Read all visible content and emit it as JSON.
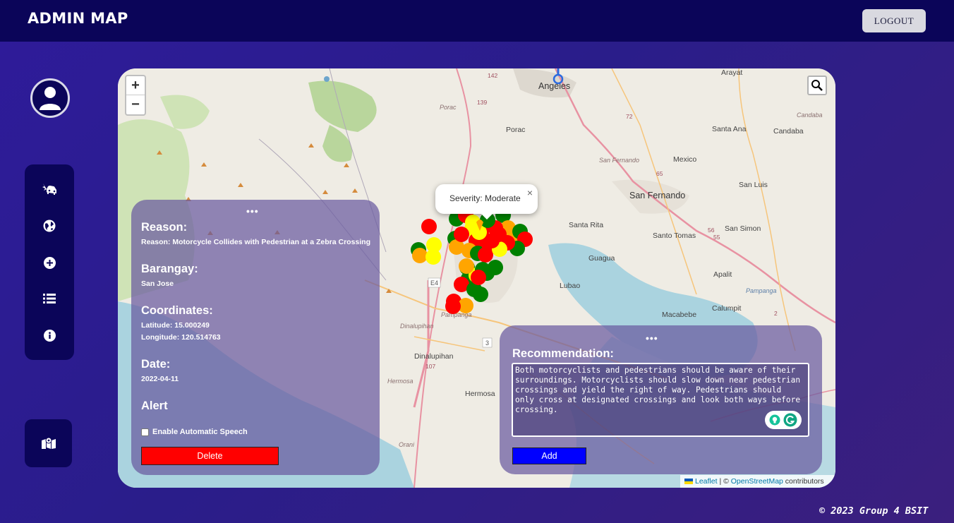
{
  "header": {
    "title": "ADMIN MAP",
    "logout_label": "LOGOUT"
  },
  "sidebar": {
    "items": [
      {
        "name": "car-crash-icon",
        "label": "Accidents"
      },
      {
        "name": "globe-icon",
        "label": "Globe"
      },
      {
        "name": "plus-circle-icon",
        "label": "Add"
      },
      {
        "name": "list-icon",
        "label": "List"
      },
      {
        "name": "info-icon",
        "label": "Info"
      }
    ],
    "map_item": {
      "name": "map-icon"
    }
  },
  "map": {
    "zoom_in": "+",
    "zoom_out": "−",
    "labels": {
      "angeles": "Angeles",
      "arayat": "Arayat",
      "porac": "Porac",
      "porac_small": "Porac",
      "santa_ana": "Santa Ana",
      "candaba": "Candaba",
      "candaba_small": "Candaba",
      "mexico": "Mexico",
      "san_fernando": "San Fernando",
      "san_fernando_small": "San Fernando",
      "san_luis": "San Luis",
      "santa_rita": "Santa Rita",
      "santo_tomas": "Santo Tomas",
      "san_simon": "San Simon",
      "guagua": "Guagua",
      "lubao": "Lubao",
      "apalit": "Apalit",
      "pampanga": "Pampanga",
      "pampanga_river": "Pampanga",
      "macabebe": "Macabebe",
      "calumpit": "Calumpit",
      "dinalupihan": "Dinalupihan",
      "dinalupihan_small": "Dinalupihan",
      "hermosa": "Hermosa",
      "hermosa_small": "Hermosa",
      "orani": "Orani",
      "road_142": "142",
      "road_139": "139",
      "road_72": "72",
      "road_65": "65",
      "road_56": "56",
      "road_55": "55",
      "road_107": "107",
      "road_e4": "E4",
      "road_3": "3",
      "road_2": "2"
    },
    "popup": {
      "text": "Severity: Moderate",
      "close": "×"
    },
    "attribution": {
      "leaflet": "Leaflet",
      "sep": " | © ",
      "osm": "OpenStreetMap",
      "suffix": " contributors"
    },
    "severity_colors": {
      "high": "#ff0000",
      "moderate": "#ffa500",
      "low": "#ffff00",
      "minor": "#008000"
    }
  },
  "details": {
    "menu": "•••",
    "reason_title": "Reason:",
    "reason_value": "Reason: Motorcycle Collides with Pedestrian at a Zebra Crossing",
    "barangay_title": "Barangay:",
    "barangay_value": "San Jose",
    "coordinates_title": "Coordinates:",
    "latitude": "Latitude: 15.000249",
    "longitude": "Longitude: 120.514763",
    "date_title": "Date:",
    "date_value": "2022-04-11",
    "alert_title": "Alert",
    "speech_label": "Enable Automatic Speech",
    "delete_label": "Delete"
  },
  "recommendation": {
    "menu": "•••",
    "title": "Recommendation:",
    "text": "Both motorcyclists and pedestrians should be aware of their\nsurroundings. Motorcyclists should slow down near pedestrian\ncrossings and yield the right of way. Pedestrians should\nonly cross at designated crossings and look both ways before\ncrossing.",
    "add_label": "Add"
  },
  "footer": {
    "text": "© 2023 Group 4 BSIT"
  }
}
